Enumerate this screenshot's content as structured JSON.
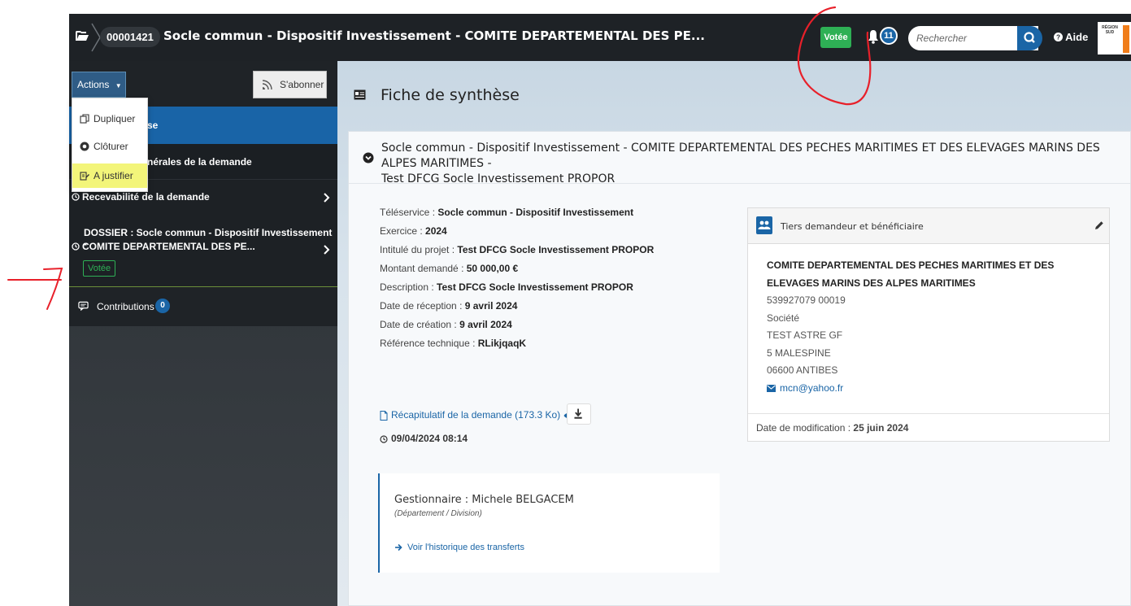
{
  "topbar": {
    "dossier_id": "00001421",
    "title": "Socle commun - Dispositif Investissement - COMITE DEPARTEMENTAL DES PE...",
    "status": "Votée",
    "notifications": "11",
    "search_placeholder": "Rechercher",
    "help": "Aide",
    "logo_text": "RÉGION SUD"
  },
  "sidebar": {
    "actions_label": "Actions",
    "subscribe_label": "S'abonner",
    "active_item": "se",
    "general_item": "nérales de la demande",
    "recevabilite_item": "Recevabilité de la demande",
    "dossier_line1": "DOSSIER : Socle commun - Dispositif Investissement -",
    "dossier_line2": "COMITE DEPARTEMENTAL DES PE...",
    "dossier_status": "Votée",
    "contributions_label": "Contributions",
    "contributions_count": "0"
  },
  "actions_menu": {
    "items": [
      "Dupliquer",
      "Clôturer",
      "A justifier"
    ]
  },
  "main": {
    "title": "Fiche de synthèse",
    "panel_title_line1": "Socle commun - Dispositif Investissement - COMITE DEPARTEMENTAL DES PECHES MARITIMES ET DES ELEVAGES MARINS DES ALPES MARITIMES -",
    "panel_title_line2": "Test DFCG Socle Investissement PROPOR",
    "details": [
      {
        "label": "Téléservice : ",
        "value": "Socle commun - Dispositif Investissement"
      },
      {
        "label": "Exercice : ",
        "value": "2024"
      },
      {
        "label": "Intitulé du projet : ",
        "value": "Test DFCG Socle Investissement PROPOR"
      },
      {
        "label": "Montant demandé : ",
        "value": "50 000,00 €"
      },
      {
        "label": "Description : ",
        "value": "Test DFCG Socle Investissement PROPOR"
      },
      {
        "label": "Date de réception : ",
        "value": "9 avril 2024"
      },
      {
        "label": "Date de création : ",
        "value": "9 avril 2024"
      },
      {
        "label": "Référence technique : ",
        "value": "RLikjqaqK"
      }
    ],
    "recap_link": "Récapitulatif de la demande (173.3 Ko)",
    "recap_datetime": "09/04/2024 08:14",
    "gestionnaire": "Gestionnaire : Michele BELGACEM",
    "gestionnaire_sub": "(Département / Division)",
    "transfer_link": "Voir l'historique des transferts"
  },
  "tiers": {
    "title": "Tiers demandeur et bénéficiaire",
    "name": "COMITE DEPARTEMENTAL DES PECHES MARITIMES ET DES ELEVAGES MARINS DES ALPES MARITIMES",
    "siret": "539927079 00019",
    "type": "Société",
    "contact": "TEST ASTRE GF",
    "address": "5 MALESPINE",
    "city": "06600 ANTIBES",
    "email": "mcn@yahoo.fr",
    "modified_label": "Date de modification : ",
    "modified_value": "25 juin 2024"
  },
  "colors": {
    "topbar": "#1e2226",
    "accent_blue": "#1a65a6",
    "status_green": "#2eb055",
    "highlight_yellow": "#f3f57a",
    "annotation_red": "#e8202a"
  }
}
